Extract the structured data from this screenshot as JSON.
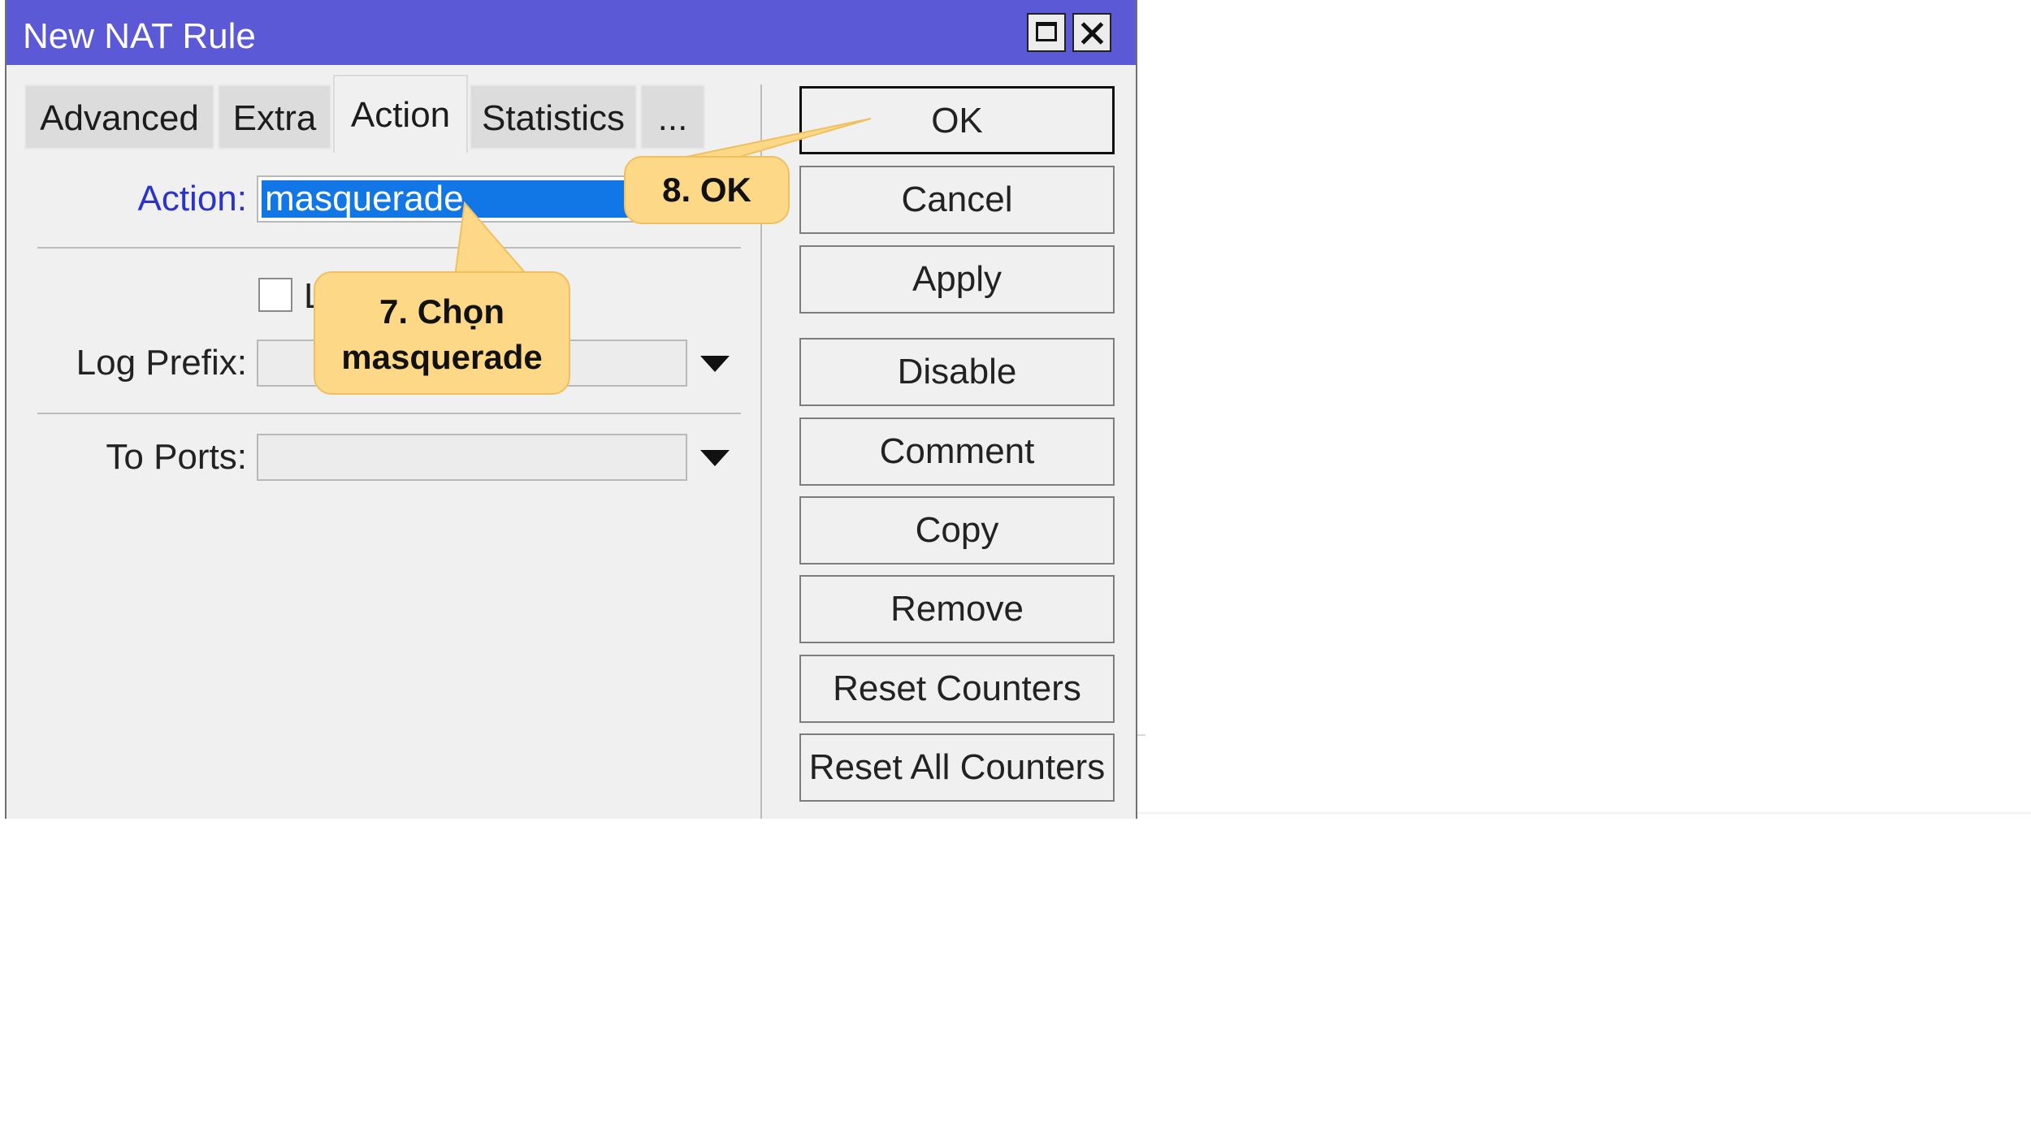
{
  "window": {
    "title": "New NAT Rule"
  },
  "tabs": [
    {
      "label": "Advanced",
      "active": false
    },
    {
      "label": "Extra",
      "active": false
    },
    {
      "label": "Action",
      "active": true
    },
    {
      "label": "Statistics",
      "active": false
    },
    {
      "label": "...",
      "active": false
    }
  ],
  "form": {
    "action_label": "Action:",
    "action_value": "masquerade",
    "log_checkbox_partial_label": "L",
    "log_prefix_label": "Log Prefix:",
    "log_prefix_value": "",
    "to_ports_label": "To Ports:",
    "to_ports_value": ""
  },
  "buttons": {
    "ok": "OK",
    "cancel": "Cancel",
    "apply": "Apply",
    "disable": "Disable",
    "comment": "Comment",
    "copy": "Copy",
    "remove": "Remove",
    "reset_counters": "Reset Counters",
    "reset_all_counters": "Reset All Counters"
  },
  "callouts": {
    "step7_line1": "7. Chọn",
    "step7_line2": "masquerade",
    "step8": "8. OK"
  },
  "colors": {
    "titlebar": "#5b59d6",
    "selection": "#1177e6",
    "callout": "#fdd886",
    "label_blue": "#2b33c9"
  },
  "icons": {
    "maximize": "maximize-icon",
    "close": "close-icon",
    "dropdown": "triangle-down-icon"
  }
}
